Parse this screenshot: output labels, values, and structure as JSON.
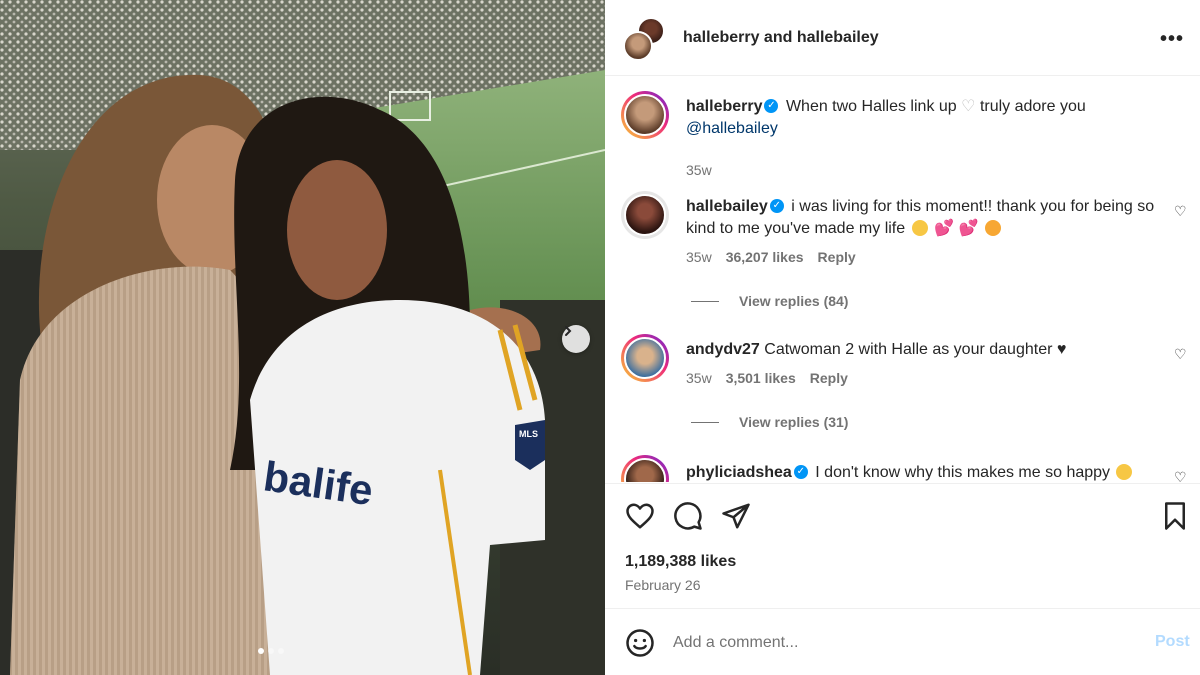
{
  "post": {
    "header_title": "halleberry and hallebailey",
    "more_label": "•••",
    "likes": "1,189,388 likes",
    "date": "February 26",
    "carousel": {
      "slides": 3,
      "active": 0
    }
  },
  "caption": {
    "username": "halleberry",
    "text": "When two Halles link up",
    "text_after": "truly adore you",
    "mention": "@hallebailey",
    "time": "35w"
  },
  "comments": [
    {
      "username": "hallebailey",
      "verified": true,
      "text": "i was living for this moment!! thank you for being so kind to me you've made my life",
      "time": "35w",
      "likes": "36,207 likes",
      "reply": "Reply",
      "view_replies": "View replies (84)"
    },
    {
      "username": "andydv27",
      "verified": false,
      "text": "Catwoman 2 with Halle as your daughter",
      "time": "35w",
      "likes": "3,501 likes",
      "reply": "Reply",
      "view_replies": "View replies (31)"
    },
    {
      "username": "phyliciadshea",
      "verified": true,
      "text": "I don't know why this makes me so happy"
    }
  ],
  "composer": {
    "placeholder": "Add a comment...",
    "post_label": "Post"
  },
  "photo_text": {
    "jersey_sponsor": "balife",
    "badge": "MLS"
  },
  "colors": {
    "accent_blue": "#0095f6",
    "post_disabled": "#b3dbff",
    "secondary_text": "#737373"
  },
  "icons": [
    "heart-icon",
    "comment-icon",
    "share-icon",
    "bookmark-icon",
    "emoji-icon",
    "verified-icon",
    "chevron-right-icon"
  ]
}
